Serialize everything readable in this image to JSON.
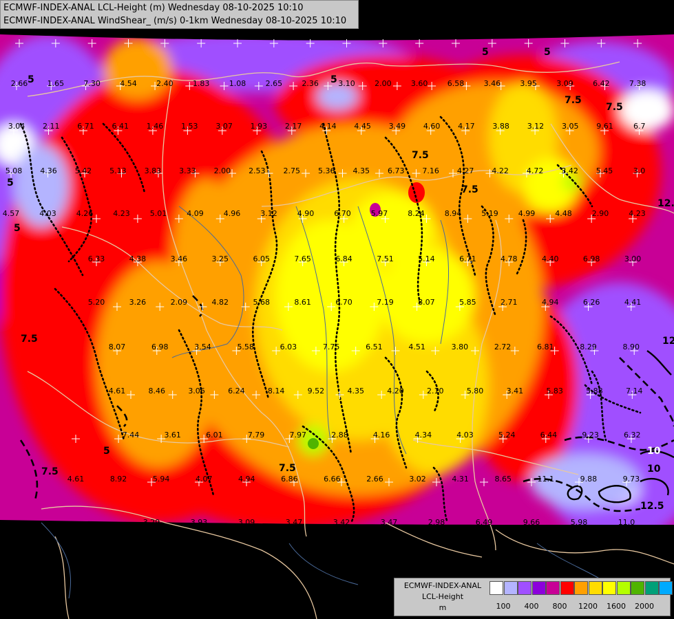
{
  "header": {
    "line1": "ECMWF-INDEX-ANAL LCL-Height (m) Wednesday 08-10-2025 10:10",
    "line2": "ECMWF-INDEX-ANAL WindShear_ (m/s) 0-1km Wednesday 08-10-2025 10:10"
  },
  "legend": {
    "name1": "ECMWF-INDEX-ANAL",
    "name2": "LCL-Height",
    "name3": "m",
    "colors": [
      "#ffffff",
      "#b4b4ff",
      "#a050ff",
      "#8c00dc",
      "#c80096",
      "#ff0000",
      "#ffa000",
      "#ffdc00",
      "#ffff00",
      "#b4ff00",
      "#50b400",
      "#00a078",
      "#00aaff"
    ],
    "ticks": [
      "100",
      "400",
      "800",
      "1200",
      "1600",
      "2000"
    ]
  },
  "contour_labels": [
    "5",
    "7.5",
    "10",
    "12.5",
    "5",
    "7.5",
    "7.5",
    "5",
    "5",
    "7.5",
    "7.5",
    "10",
    "12.5",
    "12.5",
    "5",
    "7.5",
    "5",
    "7.5",
    "5"
  ],
  "grid_values": [
    "2.66",
    "1.65",
    "7.30",
    "4.54",
    "2.40",
    "1.83",
    "1.08",
    "2.65",
    "2.36",
    "3.10",
    "2.00",
    "3.60",
    "6.58",
    "3.46",
    "3.95",
    "3.09",
    "6.42",
    "7.38",
    "3.04",
    "2.11",
    "6.71",
    "6.41",
    "1.46",
    "1.53",
    "3.07",
    "1.93",
    "2.17",
    "4.14",
    "4.45",
    "3.49",
    "4.60",
    "4.17",
    "3.88",
    "3.12",
    "3.05",
    "9.61",
    "6.7",
    "5.08",
    "4.36",
    "5.42",
    "5.13",
    "3.83",
    "3.33",
    "2.00",
    "2.53",
    "2.75",
    "5.36",
    "4.35",
    "6.73",
    "7.16",
    "4.27",
    "4.22",
    "4.72",
    "3.42",
    "5.45",
    "3.0",
    "4.57",
    "4.03",
    "4.26",
    "4.23",
    "5.01",
    "4.09",
    "4.96",
    "3.12",
    "4.90",
    "6.70",
    "5.97",
    "8.24",
    "8.94",
    "5.19",
    "4.99",
    "4.48",
    "2.90",
    "4.23",
    "6.33",
    "4.38",
    "3.46",
    "3.25",
    "6.05",
    "7.65",
    "6.84",
    "7.51",
    "5.14",
    "6.71",
    "4.78",
    "4.40",
    "6.98",
    "3.00",
    "5.20",
    "3.26",
    "2.09",
    "4.82",
    "5.68",
    "8.61",
    "6.70",
    "7.19",
    "8.07",
    "5.85",
    "2.71",
    "4.94",
    "6.26",
    "4.41",
    "8.07",
    "6.98",
    "3.54",
    "5.58",
    "6.03",
    "7.75",
    "6.51",
    "4.51",
    "3.80",
    "2.72",
    "6.81",
    "8.29",
    "8.90",
    "4.61",
    "8.46",
    "3.06",
    "6.24",
    "8.14",
    "9.52",
    "4.35",
    "4.20",
    "2.10",
    "5.80",
    "3.41",
    "5.83",
    "5.88",
    "7.14",
    "7.44",
    "3.61",
    "6.01",
    "7.79",
    "7.97",
    "2.88",
    "4.16",
    "4.34",
    "4.03",
    "5.24",
    "6.44",
    "9.23",
    "6.32",
    "4.61",
    "8.92",
    "5.94",
    "4.07",
    "4.94",
    "6.86",
    "6.66",
    "2.66",
    "3.02",
    "4.31",
    "8.65",
    "11.1",
    "9.88",
    "9.73",
    "3.29",
    "3.93",
    "3.09",
    "3.47",
    "3.42",
    "3.47",
    "2.98",
    "6.49",
    "9.66",
    "5.98",
    "11.0"
  ]
}
